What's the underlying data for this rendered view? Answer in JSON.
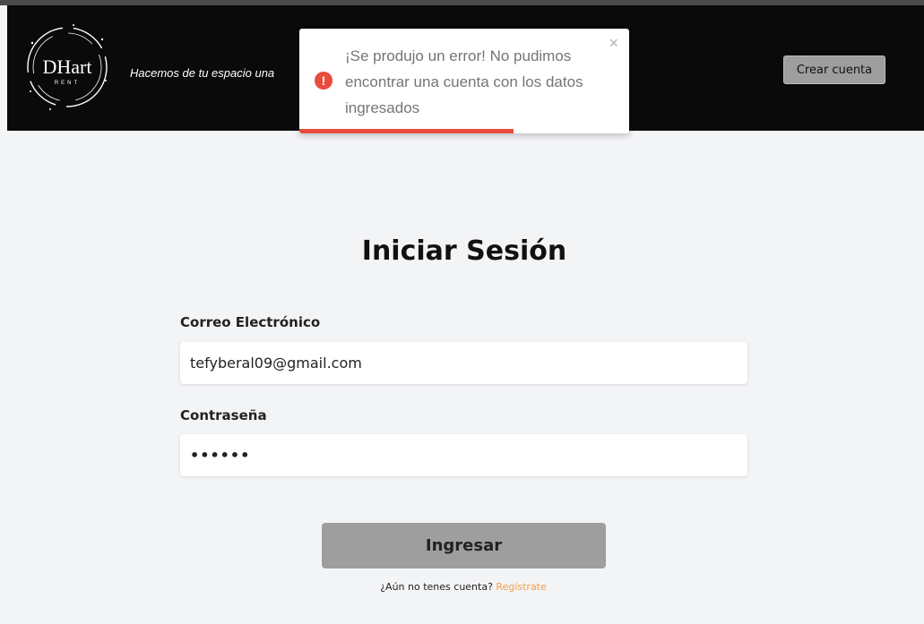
{
  "header": {
    "logo_text": "DHart",
    "logo_subtext": "RENT",
    "tagline": "Hacemos de tu espacio una",
    "create_account_label": "Crear cuenta"
  },
  "toast": {
    "message": "¡Se produjo un error! No pudimos encontrar una cuenta con los datos ingresados",
    "icon": "!",
    "close": "×",
    "progress_percent": 65,
    "accent_color": "#e74c3c"
  },
  "login": {
    "title": "Iniciar Sesión",
    "email_label": "Correo Electrónico",
    "email_value": "tefyberal09@gmail.com",
    "password_label": "Contraseña",
    "password_value": "••••••",
    "submit_label": "Ingresar",
    "signup_prompt": "¿Aún no tenes cuenta?",
    "signup_link": "Regístrate",
    "link_color": "#f59e42"
  }
}
